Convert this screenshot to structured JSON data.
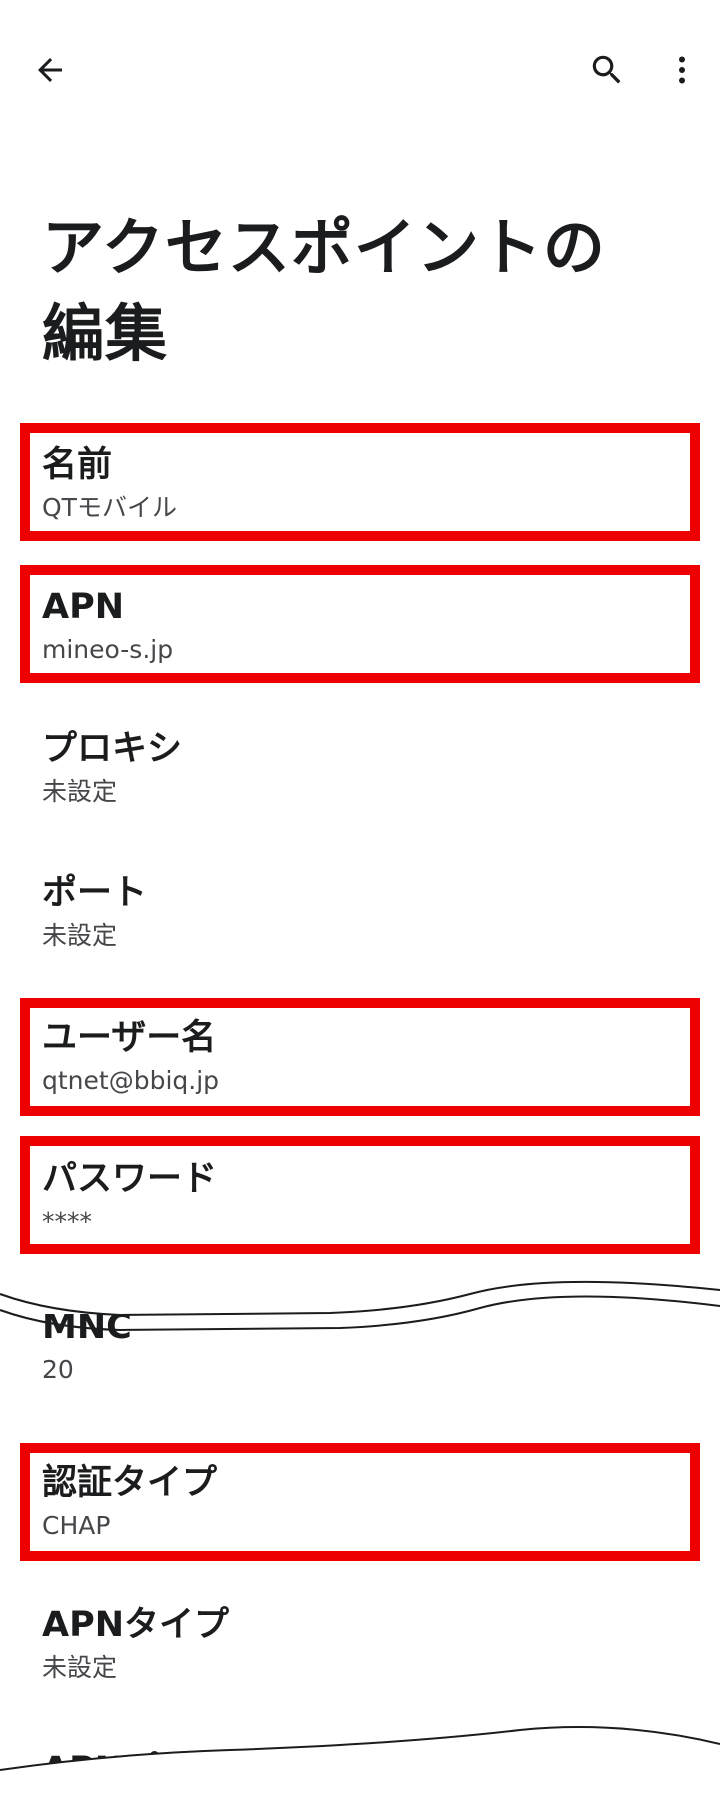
{
  "toolbar": {
    "back_icon": "arrow-back-icon",
    "search_icon": "search-icon",
    "more_icon": "more-vert-icon"
  },
  "page": {
    "title": "アクセスポイントの編集"
  },
  "items": [
    {
      "title": "名前",
      "summary": "QTモバイル",
      "highlighted": true
    },
    {
      "title": "APN",
      "summary": "mineo-s.jp",
      "highlighted": true
    },
    {
      "title": "プロキシ",
      "summary": "未設定",
      "highlighted": false
    },
    {
      "title": "ポート",
      "summary": "未設定",
      "highlighted": false
    },
    {
      "title": "ユーザー名",
      "summary": "qtnet@bbiq.jp",
      "highlighted": true
    },
    {
      "title": "パスワード",
      "summary": "****",
      "highlighted": true
    },
    {
      "title": "MNC",
      "summary": "20",
      "highlighted": false
    },
    {
      "title": "認証タイプ",
      "summary": "CHAP",
      "highlighted": true
    },
    {
      "title": "APNタイプ",
      "summary": "未設定",
      "highlighted": false
    },
    {
      "title": "APNプロトコル",
      "summary": "",
      "highlighted": false
    }
  ],
  "colors": {
    "highlight_border": "#ee0000",
    "text_primary": "#1b1c1e",
    "text_secondary": "#45474a",
    "background": "#ffffff"
  }
}
